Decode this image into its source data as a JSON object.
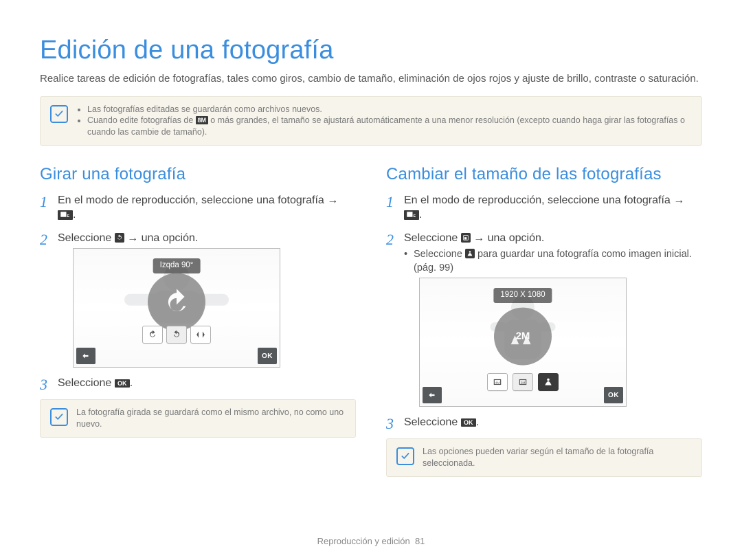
{
  "title": "Edición de una fotografía",
  "intro": "Realice tareas de edición de fotografías, tales como giros, cambio de tamaño, eliminación de ojos rojos y ajuste de brillo, contraste o saturación.",
  "top_note": {
    "bullets": [
      "Las fotografías editadas se guardarán como archivos nuevos.",
      "Cuando edite fotografías de 8M o más grandes, el tamaño se ajustará automáticamente a una menor resolución (excepto cuando haga girar las fotografías o cuando las cambie de tamaño)."
    ],
    "size_badge": "8M"
  },
  "left": {
    "heading": "Girar una fotografía",
    "steps": {
      "s1": {
        "text_a": "En el modo de reproducción, seleccione una fotografía →",
        "edit_icon": "edit-icon",
        "text_b": "."
      },
      "s2": {
        "text_a": "Seleccione ",
        "icon": "rotate-icon",
        "text_b": " → una opción."
      },
      "s3": {
        "text_a": "Seleccione ",
        "ok_label": "OK",
        "text_b": "."
      }
    },
    "screen": {
      "pill": "Izqda 90°",
      "option_icons": [
        "rotate-right",
        "rotate-left",
        "flip"
      ],
      "ok": "OK"
    },
    "note": "La fotografía girada se guardará como el mismo archivo, no como uno nuevo."
  },
  "right": {
    "heading": "Cambiar el tamaño de las fotografías",
    "steps": {
      "s1": {
        "text_a": "En el modo de reproducción, seleccione una fotografía →",
        "edit_icon": "edit-icon",
        "text_b": "."
      },
      "s2": {
        "text_a": "Seleccione ",
        "icon": "resize-icon",
        "text_b": " → una opción.",
        "sub_a": "Seleccione ",
        "start_icon": "startimg-icon",
        "sub_b": " para guardar una fotografía como imagen inicial. (pág. 99)"
      },
      "s3": {
        "text_a": "Seleccione ",
        "ok_label": "OK",
        "text_b": "."
      }
    },
    "screen": {
      "pill": "1920 X 1080",
      "center_label": "2M",
      "option_icons": [
        "size-4m",
        "size-2m",
        "startimg"
      ],
      "ok": "OK"
    },
    "note": "Las opciones pueden variar según el tamaño de la fotografía seleccionada."
  },
  "footer": {
    "section": "Reproducción y edición",
    "page": "81"
  }
}
